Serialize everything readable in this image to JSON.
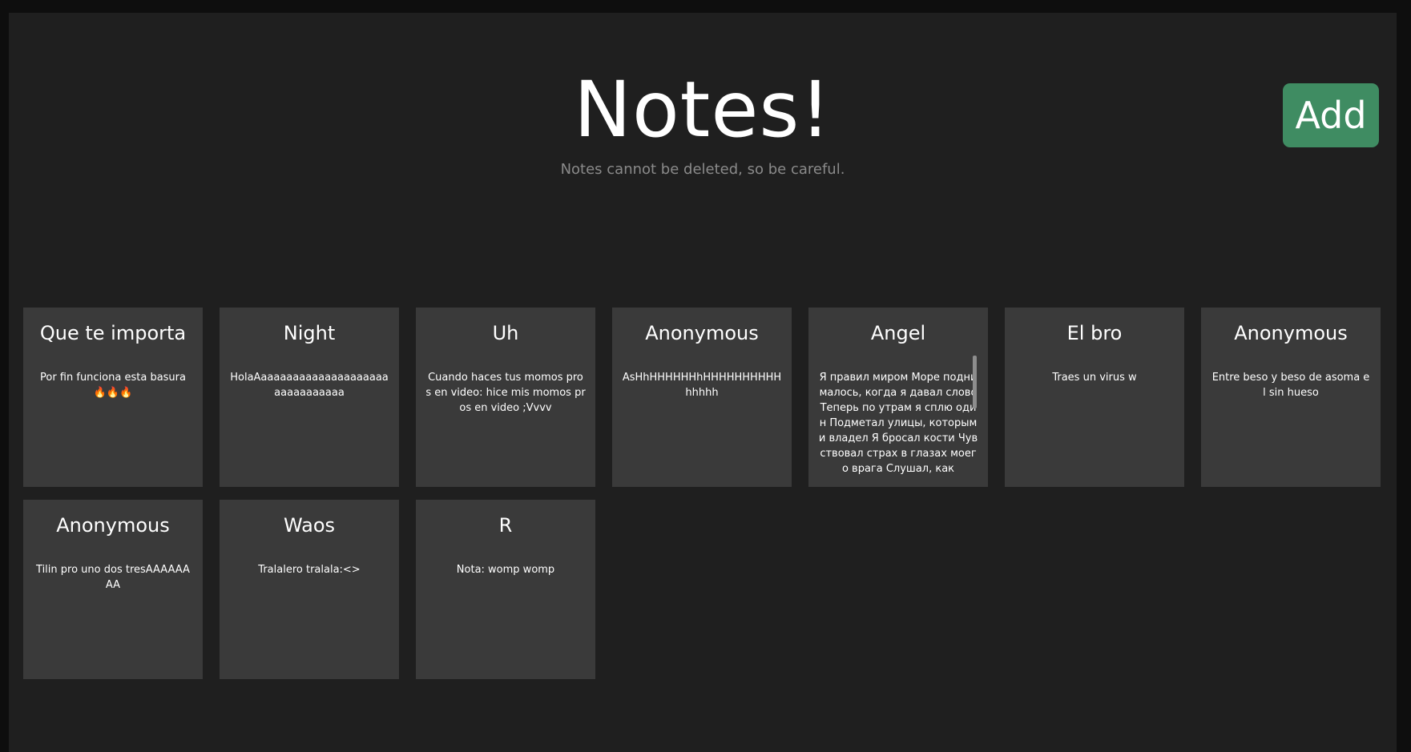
{
  "header": {
    "title": "Notes!",
    "subtitle": "Notes cannot be deleted, so be careful.",
    "add_label": "Add"
  },
  "notes": [
    {
      "title": "Que te importa",
      "body": "Por fin funciona esta basura 🔥🔥🔥"
    },
    {
      "title": "Night",
      "body": "HolaAaaaaaaaaaaaaaaaaaaaaaaaaaaaaaaa"
    },
    {
      "title": "Uh",
      "body": "Cuando haces tus momos pros en video: hice mis momos pros en video ;Vvvv"
    },
    {
      "title": "Anonymous",
      "body": "AsHhHHHHHHhHHHHHHHHHHhhhhh"
    },
    {
      "title": "Angel",
      "body": "Я правил миром Море поднималось, когда я давал слово Теперь по утрам я сплю один Подметал улицы, которыми владел Я бросал кости Чувствовал страх в глазах моего врага Слушал, как"
    },
    {
      "title": "El bro",
      "body": "Traes un virus w"
    },
    {
      "title": "Anonymous",
      "body": "Entre beso y beso de asoma el sin hueso"
    },
    {
      "title": "Anonymous",
      "body": "Tilin pro uno dos tresAAAAAAAA"
    },
    {
      "title": "Waos",
      "body": "Tralalero tralala:<>"
    },
    {
      "title": "R",
      "body": "Nota: womp womp"
    }
  ]
}
